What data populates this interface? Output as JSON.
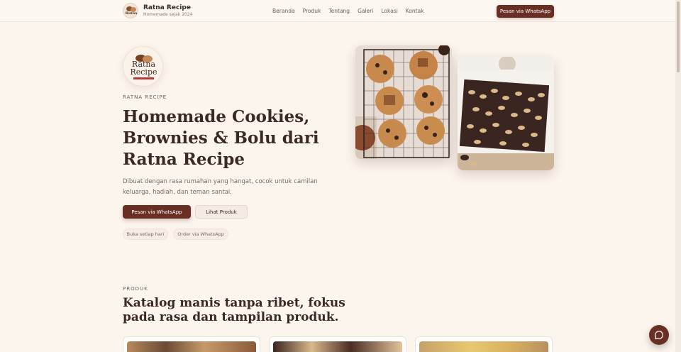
{
  "header": {
    "brand_name": "Ratna Recipe",
    "brand_tagline": "Homemade sejak 2024",
    "logo_text_1": "Ratna",
    "logo_text_2": "Recipe",
    "nav": [
      {
        "label": "Beranda"
      },
      {
        "label": "Produk"
      },
      {
        "label": "Tentang"
      },
      {
        "label": "Galeri"
      },
      {
        "label": "Lokasi"
      },
      {
        "label": "Kontak"
      }
    ],
    "cta_label": "Pesan via WhatsApp"
  },
  "hero": {
    "logo_text_1": "Ratna",
    "logo_text_2": "Recipe",
    "eyebrow": "RATNA RECIPE",
    "title": "Homemade Cookies, Brownies & Bolu dari Ratna Recipe",
    "subtitle": "Dibuat dengan rasa rumahan yang hangat, cocok untuk camilan keluarga, hadiah, dan teman santai.",
    "primary_button": "Pesan via WhatsApp",
    "secondary_button": "Lihat Produk",
    "pills": [
      "Buka setiap hari",
      "Order via WhatsApp"
    ],
    "images": [
      "cookies-on-cooling-rack",
      "brownies-with-almonds-in-box"
    ]
  },
  "products": {
    "eyebrow": "PRODUK",
    "title": "Katalog manis tanpa ribet, fokus pada rasa dan tampilan produk."
  },
  "colors": {
    "primary": "#6a2f24",
    "background": "#fcf5ee",
    "text": "#3a2a24"
  },
  "icons": {
    "chat_button": "chat-bubble-icon"
  }
}
